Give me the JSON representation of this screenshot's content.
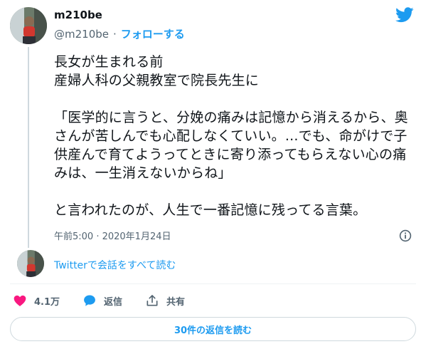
{
  "author": {
    "name": "m210be",
    "handle": "@m210be",
    "separator": "·",
    "follow_label": "フォローする"
  },
  "tweet": {
    "text": "長女が生まれる前\n産婦人科の父親教室で院長先生に\n\n「医学的に言うと、分娩の痛みは記憶から消えるから、奥さんが苦しんでも心配しなくていい。...でも、命がけで子供産んで育てようってときに寄り添ってもらえない心の痛みは、一生消えないからね」\n\nと言われたのが、人生で一番記憶に残ってる言葉。",
    "timestamp": "午前5:00 · 2020年1月24日"
  },
  "thread": {
    "read_all_label": "Twitterで会話をすべて読む"
  },
  "actions": {
    "like_count": "4.1万",
    "reply_label": "返信",
    "share_label": "共有"
  },
  "replies_button_label": "30件の返信を読む",
  "colors": {
    "accent": "#1d9bf0",
    "like": "#f91880",
    "text": "#0f1419",
    "muted": "#536471"
  },
  "icons": [
    "twitter-bird-icon",
    "info-icon",
    "heart-icon",
    "reply-bubble-icon",
    "share-icon"
  ]
}
